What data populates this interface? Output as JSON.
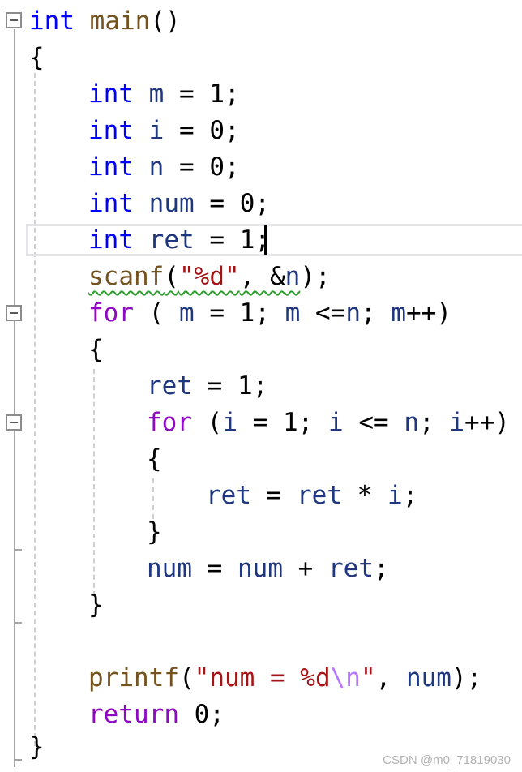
{
  "editor": {
    "lines": [
      [
        "int",
        "main",
        "()"
      ],
      [
        "{"
      ],
      [
        "int",
        "m",
        "=",
        "1;"
      ],
      [
        "int",
        "i",
        "=",
        "0;"
      ],
      [
        "int",
        "n",
        "=",
        "0;"
      ],
      [
        "int",
        "num",
        "=",
        "0;"
      ],
      [
        "int",
        "ret",
        "=",
        "1;"
      ],
      [
        "scanf",
        "(",
        "\"%d\"",
        ", &",
        "n",
        ");"
      ],
      [
        "for",
        "( ",
        "m",
        " = 1; ",
        "m",
        " <=",
        "n",
        "; ",
        "m",
        "++)"
      ],
      [
        "{"
      ],
      [
        "ret",
        " = 1;"
      ],
      [
        "for",
        " (",
        "i",
        " = 1; ",
        "i",
        " <= ",
        "n",
        "; ",
        "i",
        "++)"
      ],
      [
        "{"
      ],
      [
        "ret",
        " = ",
        "ret",
        " * ",
        "i",
        ";"
      ],
      [
        "}"
      ],
      [
        "num",
        " = ",
        "num",
        " + ",
        "ret",
        ";"
      ],
      [
        "}"
      ],
      [],
      [
        "printf",
        "(",
        "\"num = %d",
        "\\n",
        "\"",
        ", ",
        "num",
        ");"
      ],
      [
        "return",
        " 0;"
      ],
      [
        "}"
      ]
    ]
  },
  "watermark": "CSDN @m0_71819030"
}
